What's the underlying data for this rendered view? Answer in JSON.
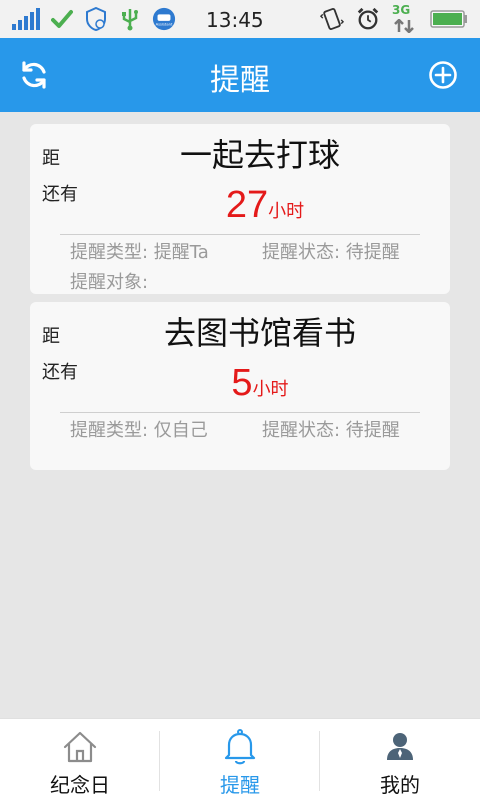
{
  "status_bar": {
    "time": "13:45",
    "network": "3G",
    "left_icons": [
      "signal-icon",
      "check-icon",
      "shield-icon",
      "usb-icon",
      "assistant-icon"
    ],
    "right_icons": [
      "vibrate-icon",
      "alarm-icon",
      "network-3g-icon",
      "battery-icon"
    ],
    "assistant_text": "Assistant"
  },
  "header": {
    "title": "提醒",
    "left_icon": "refresh-icon",
    "right_icon": "add-circle-icon",
    "color": "#2898ea"
  },
  "reminders": [
    {
      "prefix": "距",
      "remain_label": "还有",
      "title": "一起去打球",
      "count": "27",
      "unit": "小时",
      "type_text": "提醒类型: 提醒Ta",
      "status_text": "提醒状态: 待提醒",
      "target_text": "提醒对象:"
    },
    {
      "prefix": "距",
      "remain_label": "还有",
      "title": "去图书馆看书",
      "count": "5",
      "unit": "小时",
      "type_text": "提醒类型: 仅自己",
      "status_text": "提醒状态: 待提醒"
    }
  ],
  "nav": {
    "items": [
      {
        "label": "纪念日",
        "icon": "home-icon",
        "active": false
      },
      {
        "label": "提醒",
        "icon": "bell-icon",
        "active": true
      },
      {
        "label": "我的",
        "icon": "user-icon",
        "active": false
      }
    ]
  },
  "colors": {
    "accent": "#2898ea",
    "countdown": "#e41a1a",
    "meta": "#9a9a9a"
  }
}
